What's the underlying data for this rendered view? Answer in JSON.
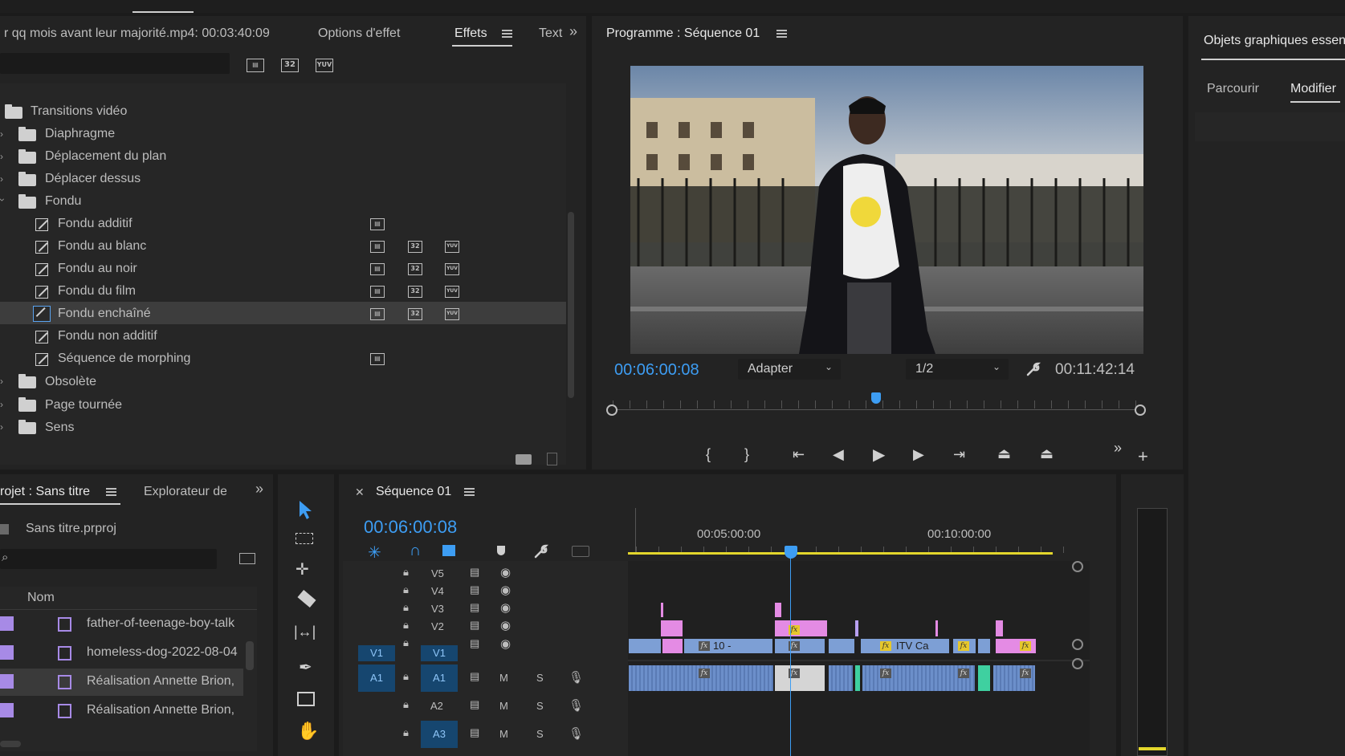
{
  "effects_panel": {
    "source_title": "r qq mois avant leur majorité.mp4: 00:03:40:09",
    "tab_options": "Options d'effet",
    "tab_effets": "Effets",
    "tab_text": "Text",
    "badge_32": "32",
    "badge_yuv": "YUV",
    "tree": [
      {
        "label": "Transitions vidéo",
        "level": 0,
        "type": "folder"
      },
      {
        "label": "Diaphragme",
        "level": 1,
        "type": "folder"
      },
      {
        "label": "Déplacement du plan",
        "level": 1,
        "type": "folder"
      },
      {
        "label": "Déplacer dessus",
        "level": 1,
        "type": "folder"
      },
      {
        "label": "Fondu",
        "level": 1,
        "type": "folder",
        "expanded": true
      },
      {
        "label": "Fondu additif",
        "level": 2,
        "type": "effect"
      },
      {
        "label": "Fondu au blanc",
        "level": 2,
        "type": "effect"
      },
      {
        "label": "Fondu au noir",
        "level": 2,
        "type": "effect"
      },
      {
        "label": "Fondu du film",
        "level": 2,
        "type": "effect"
      },
      {
        "label": "Fondu enchaîné",
        "level": 2,
        "type": "effect",
        "selected": true
      },
      {
        "label": "Fondu non additif",
        "level": 2,
        "type": "effect"
      },
      {
        "label": "Séquence de morphing",
        "level": 2,
        "type": "effect"
      },
      {
        "label": "Obsolète",
        "level": 1,
        "type": "folder"
      },
      {
        "label": "Page tournée",
        "level": 1,
        "type": "folder"
      },
      {
        "label": "Sens",
        "level": 1,
        "type": "folder"
      }
    ]
  },
  "program_monitor": {
    "title": "Programme : Séquence 01",
    "timecode": "00:06:00:08",
    "fit": "Adapter",
    "resolution": "1/2",
    "duration": "00:11:42:14",
    "playhead_fraction": 0.5
  },
  "essential_graphics": {
    "title": "Objets graphiques essen",
    "tab_browse": "Parcourir",
    "tab_edit": "Modifier"
  },
  "project_panel": {
    "title": "rojet : Sans titre",
    "tab_explorer": "Explorateur de",
    "project_file": "Sans titre.prproj",
    "column_name": "Nom",
    "items": [
      "father-of-teenage-boy-talk",
      "homeless-dog-2022-08-04",
      "Réalisation  Annette Brion,",
      "Réalisation  Annette Brion,"
    ]
  },
  "timeline": {
    "title": "Séquence 01",
    "timecode": "00:06:00:08",
    "ruler_labels": [
      "00:05:00:00",
      "00:10:00:00"
    ],
    "video_tracks": [
      "V5",
      "V4",
      "V3",
      "V2",
      "V1"
    ],
    "audio_tracks": [
      "A1",
      "A2",
      "A3"
    ],
    "source_v": "V1",
    "source_a": "A1",
    "mute_label": "M",
    "solo_label": "S",
    "clip_label_1": "10 -",
    "clip_label_2": "ITV Ca",
    "fx_label": "fx"
  }
}
